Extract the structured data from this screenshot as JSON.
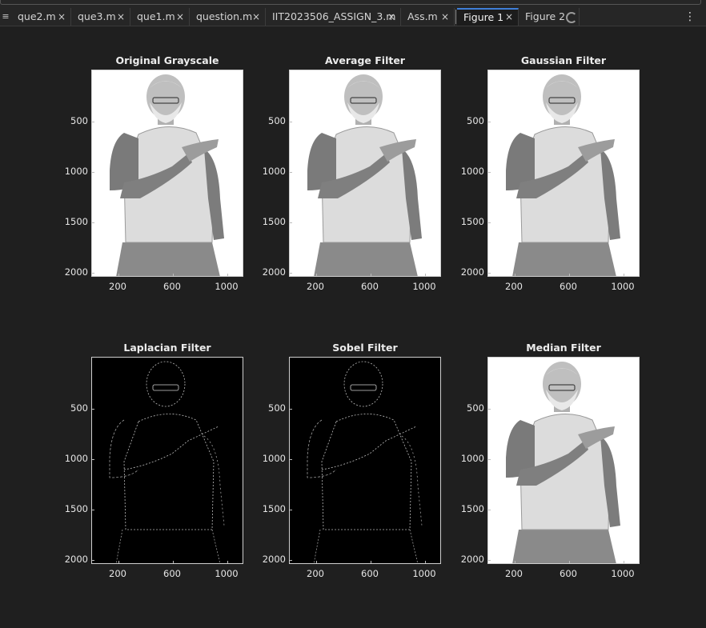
{
  "tabs": [
    {
      "label": "que2.m",
      "close": "×"
    },
    {
      "label": "que3.m",
      "close": "×"
    },
    {
      "label": "que1.m",
      "close": "×"
    },
    {
      "label": "question.m",
      "close": "×"
    },
    {
      "label": "IIT2023506_ASSIGN_3.m",
      "close": "×"
    },
    {
      "label": "Ass.m",
      "close": "×"
    },
    {
      "label": "Figure 1",
      "close": "×"
    },
    {
      "label": "Figure 2"
    }
  ],
  "icons": {
    "tab_menu": "hamburger-icon",
    "more": "vertical-ellipsis-icon",
    "loading": "spinner-icon"
  },
  "axis": {
    "yticks": [
      "500",
      "1000",
      "1500",
      "2000"
    ],
    "xticks": [
      "200",
      "600",
      "1000"
    ]
  },
  "panels": [
    {
      "title": "Original Grayscale",
      "style": "light"
    },
    {
      "title": "Average Filter",
      "style": "light"
    },
    {
      "title": "Gaussian Filter",
      "style": "light"
    },
    {
      "title": "Laplacian Filter",
      "style": "dark"
    },
    {
      "title": "Sobel Filter",
      "style": "dark"
    },
    {
      "title": "Median Filter",
      "style": "light"
    }
  ],
  "colors": {
    "background": "#1f1f1f",
    "active_tab_accent": "#3f7fd9"
  }
}
